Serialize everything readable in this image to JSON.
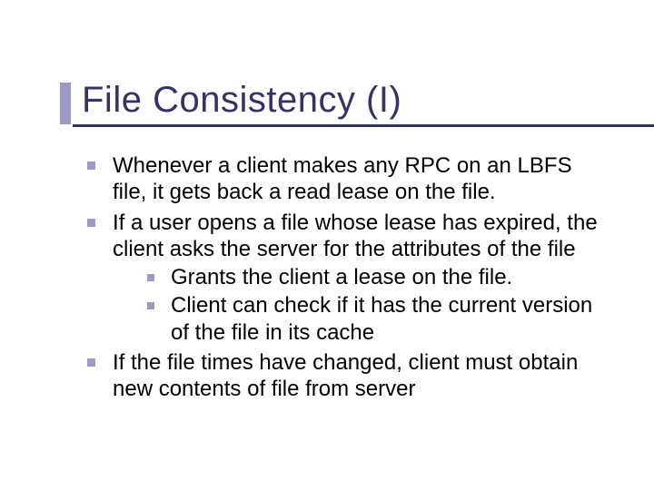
{
  "title": "File Consistency (I)",
  "bullets": [
    {
      "text": "Whenever a client makes any RPC on an LBFS file, it gets back a read lease on the file."
    },
    {
      "text": "If a user opens a file whose lease has expired,  the client asks the server for the attributes of the file",
      "children": [
        {
          "text": "Grants the client a lease on the file."
        },
        {
          "text": "Client can check if it has the current version of the file in its cache"
        }
      ]
    },
    {
      "text": "If the file times have changed, client must obtain new contents  of file from server"
    }
  ]
}
